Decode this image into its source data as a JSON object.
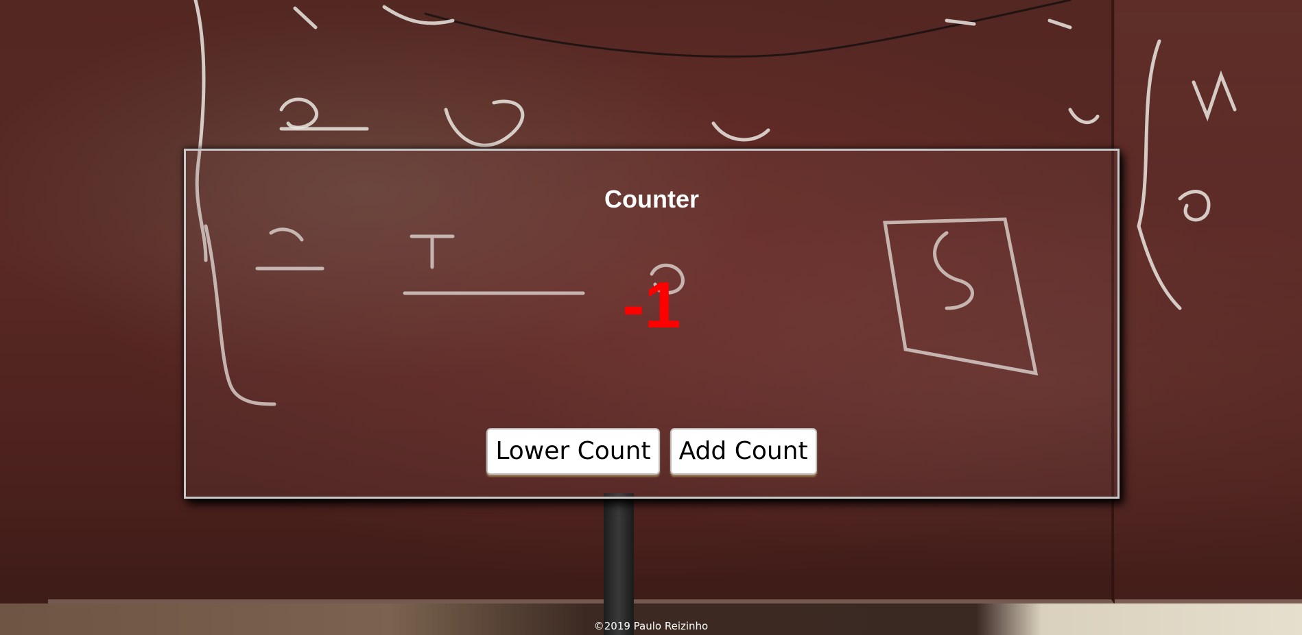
{
  "counter": {
    "title": "Counter",
    "value": "-1",
    "value_color": "#ff0000"
  },
  "buttons": {
    "lower_label": "Lower Count",
    "add_label": "Add Count"
  },
  "footer": {
    "text": "©2019 Paulo Reizinho"
  },
  "background": {
    "image": "chalkboard with handwritten equations"
  }
}
